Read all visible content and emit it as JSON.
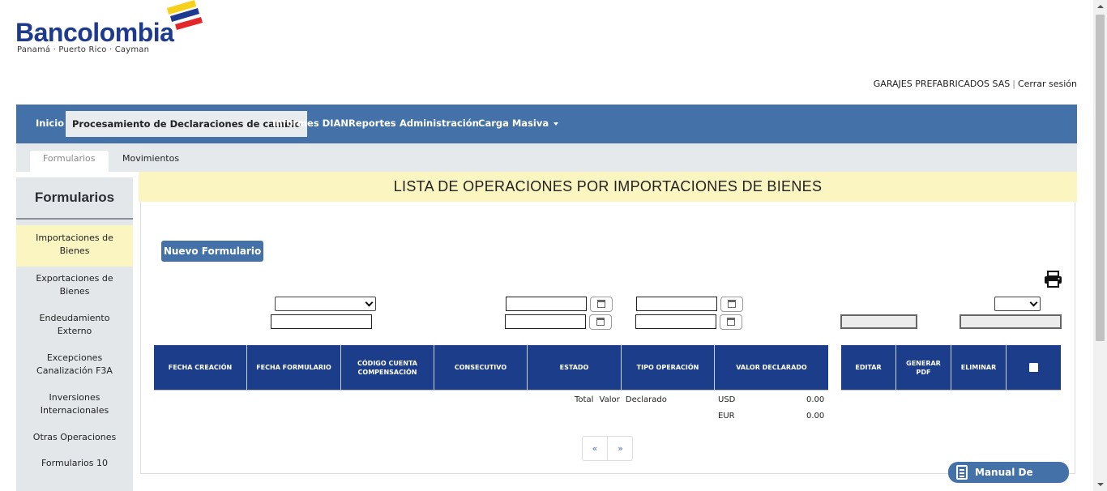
{
  "brand": {
    "name": "Bancolombia",
    "subtitle": "Panamá · Puerto Rico · Cayman",
    "colors": {
      "blue": "#1d3a8f",
      "yellow": "#f7d117",
      "red": "#e2262a"
    }
  },
  "user": {
    "company": "GARAJES PREFABRICADOS SAS",
    "separator": "|",
    "logout": "Cerrar sesión"
  },
  "nav": {
    "items": [
      {
        "label": "Inicio"
      },
      {
        "label": "Procesamiento de Declaraciones de cambio"
      },
      {
        "label": "Informes DIAN"
      },
      {
        "label": "Reportes"
      },
      {
        "label": "Administración"
      },
      {
        "label": "Carga Masiva"
      }
    ],
    "active": "Procesamiento de Declaraciones de cambio"
  },
  "tabs": [
    {
      "label": "Formularios"
    },
    {
      "label": "Movimientos"
    }
  ],
  "sidebar": {
    "title": "Formularios",
    "items": [
      {
        "label": "Importaciones de Bienes"
      },
      {
        "label": "Exportaciones de Bienes"
      },
      {
        "label": "Endeudamiento Externo"
      },
      {
        "label": "Excepciones Canalización F3A"
      },
      {
        "label": "Inversiones Internacionales"
      },
      {
        "label": "Otras Operaciones"
      },
      {
        "label": "Formularios 10"
      }
    ]
  },
  "main": {
    "title": "LISTA DE OPERACIONES POR IMPORTACIONES DE BIENES",
    "new_button": "Nuevo Formulario",
    "columns": [
      "FECHA CREACIÓN",
      "FECHA FORMULARIO",
      "CÓDIGO CUENTA COMPENSACIÓN",
      "CONSECUTIVO",
      "ESTADO",
      "TIPO OPERACIÓN",
      "VALOR DECLARADO"
    ],
    "action_columns": [
      "EDITAR",
      "GENERAR PDF",
      "ELIMINAR"
    ],
    "totals": {
      "label": "Total Valor Declarado",
      "rows": [
        {
          "currency": "USD",
          "value": "0.00"
        },
        {
          "currency": "EUR",
          "value": "0.00"
        }
      ]
    },
    "pager": {
      "prev": "«",
      "next": "»"
    }
  },
  "manual_button": "Manual De Usuario",
  "icons": [
    "print-icon",
    "calendar-icon",
    "book-icon",
    "chevron-down-icon"
  ]
}
